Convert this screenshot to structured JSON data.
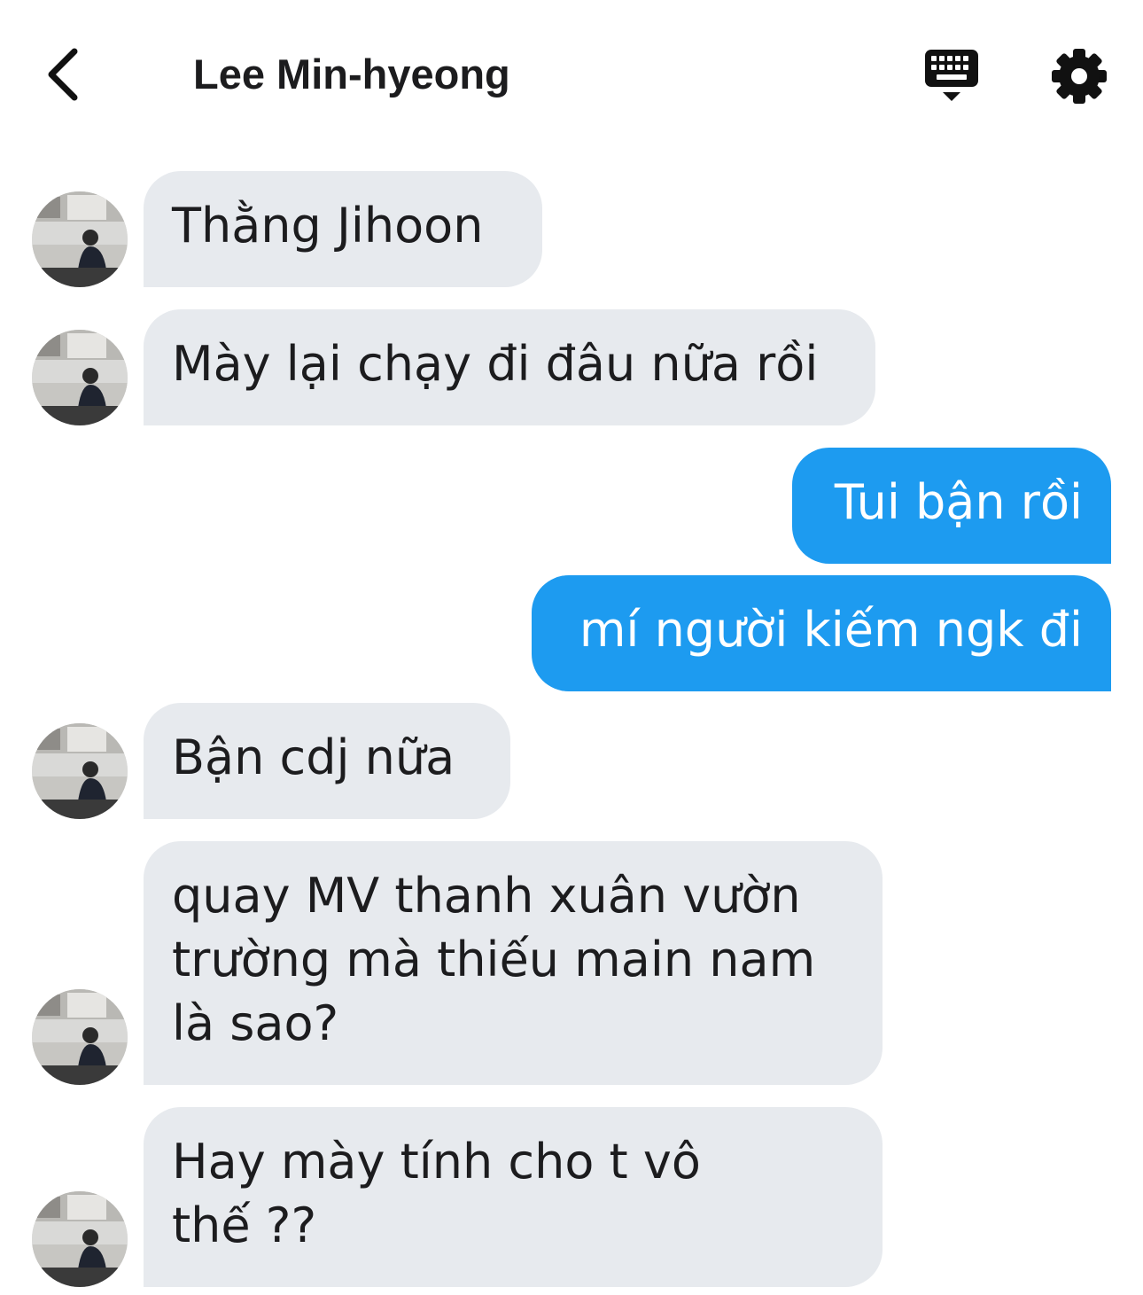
{
  "header": {
    "title": "Lee Min-hyeong",
    "back_icon": "chevron-left-icon",
    "keyboard_icon": "keyboard-icon",
    "settings_icon": "gear-icon"
  },
  "colors": {
    "incoming_bubble": "#e7eaee",
    "outgoing_bubble": "#1d9bf0",
    "text": "#1c1c1e"
  },
  "messages": [
    {
      "direction": "in",
      "text": "Thằng Jihoon"
    },
    {
      "direction": "in",
      "text": "Mày lại chạy đi đâu nữa rồi"
    },
    {
      "direction": "out",
      "text": "Tui bận rồi"
    },
    {
      "direction": "out",
      "text": "mí người kiếm ngk đi"
    },
    {
      "direction": "in",
      "text": "Bận cdj nữa"
    },
    {
      "direction": "in",
      "text": "quay MV thanh xuân vườn\ntrường mà thiếu main nam\nlà sao?"
    },
    {
      "direction": "in",
      "text": "Hay mày tính cho t vô\nthế ??"
    }
  ]
}
